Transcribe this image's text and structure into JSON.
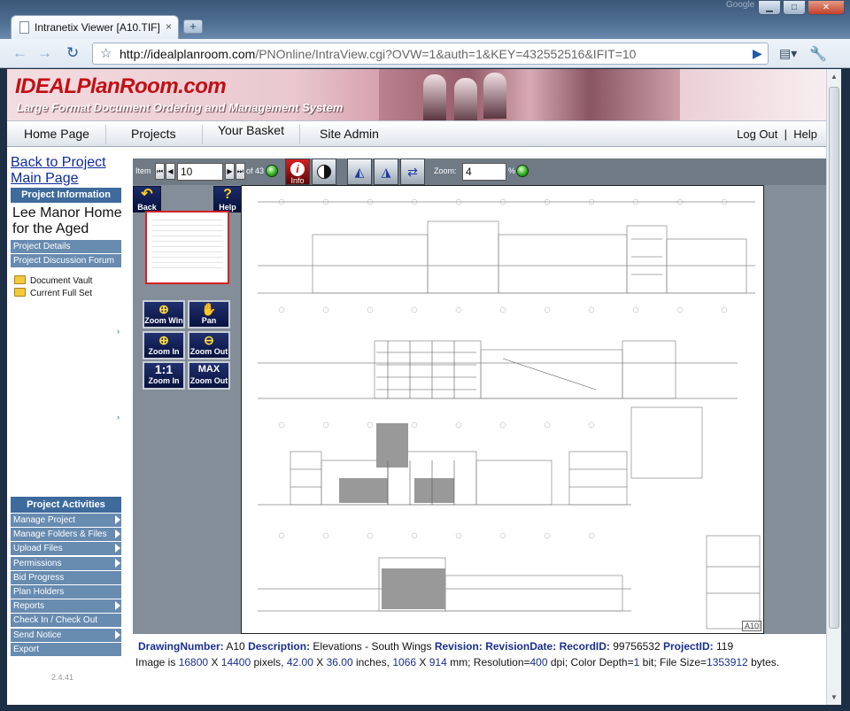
{
  "browser": {
    "tab_title": "Intranetix Viewer [A10.TIF]",
    "url_host": "http://idealplanroom.com",
    "url_path": "/PNOnline/IntraView.cgi?OVW=1&auth=1&KEY=432552516&IFIT=10",
    "google_label": "Google"
  },
  "banner": {
    "logo": "IDEALPlanRoom.com",
    "tagline": "Large Format Document Ordering and Management System"
  },
  "menu": {
    "home": "Home Page",
    "projects": "Projects",
    "basket": "Your Basket",
    "site_admin": "Site Admin",
    "logout": "Log Out",
    "sep": "|",
    "help": "Help"
  },
  "sidebar": {
    "back_link": "Back to Project Main Page",
    "project_info_head": "Project Information",
    "project_name": "Lee Manor Home for the Aged",
    "project_details": "Project Details",
    "discussion_forum": "Project Discussion Forum",
    "folders": [
      "Document Vault",
      "Current Full Set"
    ],
    "activities_head": "Project Activities",
    "activities": [
      {
        "label": "Manage Project",
        "arrow": true
      },
      {
        "label": "Manage Folders & Files",
        "arrow": true
      },
      {
        "label": "Upload Files",
        "arrow": true
      },
      {
        "label": "Permissions",
        "arrow": true
      },
      {
        "label": "Bid Progress",
        "arrow": false
      },
      {
        "label": "Plan Holders",
        "arrow": false
      },
      {
        "label": "Reports",
        "arrow": true
      },
      {
        "label": "Check In / Check Out",
        "arrow": false
      },
      {
        "label": "Send Notice",
        "arrow": true
      },
      {
        "label": "Export",
        "arrow": false
      }
    ],
    "version": "2.4.41"
  },
  "viewer": {
    "item_label": "Item",
    "item_value": "10",
    "of_label": "of 43",
    "info_label": "Info",
    "zoom_label": "Zoom:",
    "zoom_value": "4",
    "percent": "%",
    "back_label": "Back",
    "help_label": "Help",
    "tools": {
      "zoom_win": "Zoom Win",
      "pan": "Pan",
      "zoom_in": "Zoom In",
      "zoom_out": "Zoom Out",
      "one_to_one": "1:1",
      "one_to_one_sub": "Zoom In",
      "max": "MAX",
      "max_sub": "Zoom Out"
    },
    "sheet_number": "A10"
  },
  "metadata": {
    "drawing_number_label": "DrawingNumber:",
    "drawing_number": "A10",
    "description_label": "Description:",
    "description": "Elevations - South Wings",
    "revision_label": "Revision:",
    "revision_date_label": "RevisionDate:",
    "record_id_label": "RecordID:",
    "record_id": "99756532",
    "project_id_label": "ProjectID:",
    "project_id": "119",
    "image_is": "Image is",
    "px_w": "16800",
    "x1": "X",
    "px_h": "14400",
    "pixels": "pixels,",
    "in_w": "42.00",
    "x2": "X",
    "in_h": "36.00",
    "inches": "inches,",
    "mm_w": "1066",
    "x3": "X",
    "mm_h": "914",
    "mm_res": "mm; Resolution=",
    "dpi": "400",
    "dpi_depth": "dpi; Color Depth=",
    "depth": "1",
    "bit_size": "bit; File Size=",
    "file_size": "1353912",
    "bytes": "bytes."
  }
}
